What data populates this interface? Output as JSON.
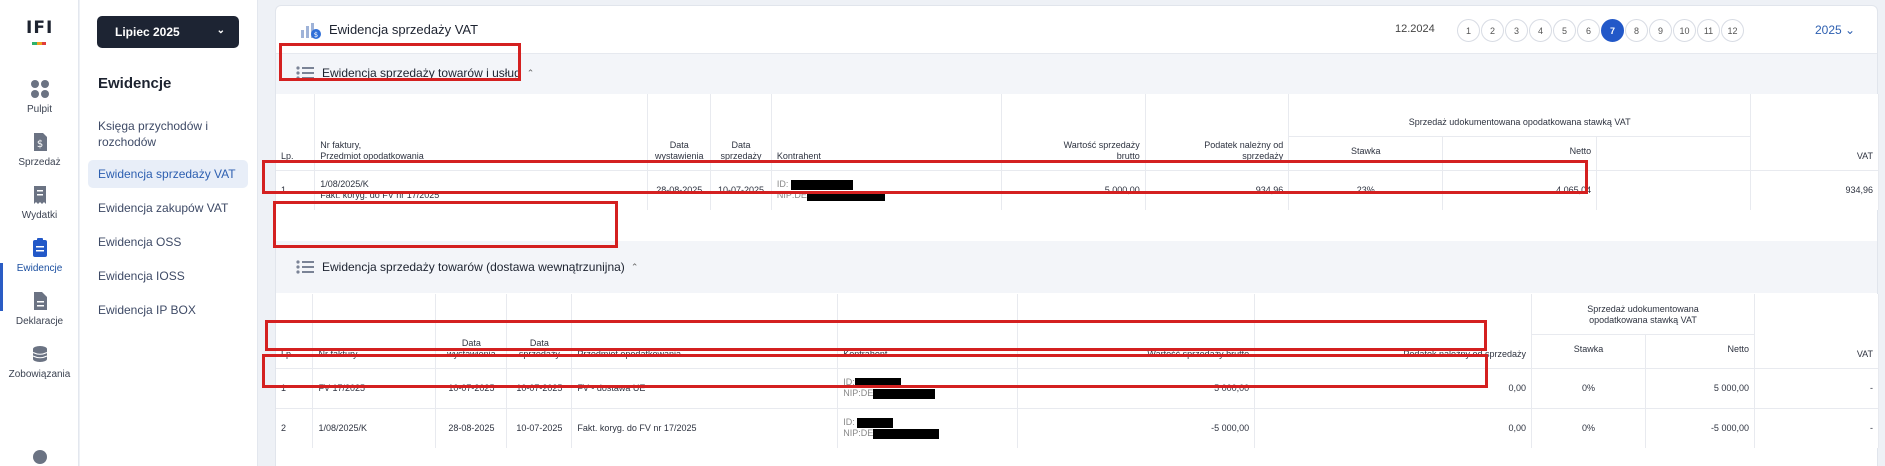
{
  "app": {
    "logo_text": "IFI",
    "month_selector": "Lipiec 2025"
  },
  "rail": [
    {
      "label": "Pulpit",
      "icon": "dashboard-icon"
    },
    {
      "label": "Sprzedaż",
      "icon": "invoice-dollar-icon"
    },
    {
      "label": "Wydatki",
      "icon": "receipt-icon"
    },
    {
      "label": "Ewidencje",
      "icon": "clipboard-icon",
      "active": true
    },
    {
      "label": "Deklaracje",
      "icon": "document-icon"
    },
    {
      "label": "Zobowiązania",
      "icon": "coins-icon"
    }
  ],
  "sidebar": {
    "title": "Ewidencje",
    "items": [
      {
        "label": "Księga przychodów i rozchodów"
      },
      {
        "label": "Ewidencja sprzedaży VAT",
        "active": true
      },
      {
        "label": "Ewidencja zakupów VAT"
      },
      {
        "label": "Ewidencja OSS"
      },
      {
        "label": "Ewidencja IOSS"
      },
      {
        "label": "Ewidencja IP BOX"
      }
    ]
  },
  "header": {
    "title": "Ewidencja sprzedaży VAT",
    "prev_period": "12.2024",
    "months": [
      "1",
      "2",
      "3",
      "4",
      "5",
      "6",
      "7",
      "8",
      "9",
      "10",
      "11",
      "12"
    ],
    "active_month": "7",
    "year": "2025",
    "year_chevron": "⌄"
  },
  "section1": {
    "title": "Ewidencja sprzedaży towarów i usług",
    "headers": {
      "lp": "Lp.",
      "nr": "Nr faktury,",
      "nr2": "Przedmiot opodatkowania",
      "data_wyst": "Data wystawienia",
      "data_sprz": "Data sprzedaży",
      "kontrahent": "Kontrahent",
      "wartosc": "Wartość sprzedaży brutto",
      "podatek": "Podatek należny od sprzedaży",
      "group": "Sprzedaż udokumentowana opodatkowana stawką VAT",
      "stawka": "Stawka",
      "netto": "Netto",
      "vat": "VAT"
    },
    "rows": [
      {
        "lp": "1",
        "nr": "1/08/2025/K",
        "przedmiot": "Fakt. koryg. do FV nr 17/2025",
        "data_wyst": "28-08-2025",
        "data_sprz": "10-07-2025",
        "id_label": "ID:",
        "nip_label": "NIP:DE",
        "wartosc": "5 000,00",
        "podatek": "934,96",
        "stawka": "23%",
        "netto": "4 065,04",
        "vat": "934,96"
      }
    ]
  },
  "section2": {
    "title": "Ewidencja sprzedaży towarów (dostawa wewnątrzunijna)",
    "headers": {
      "lp": "Lp.",
      "nr": "Nr faktury",
      "data_wyst": "Data wystawienia",
      "data_sprz": "Data sprzedaży",
      "przedmiot": "Przedmiot opodatkowania",
      "kontrahent": "Kontrahent",
      "wartosc": "Wartość sprzedaży brutto",
      "podatek": "Podatek należny od sprzedaży",
      "group": "Sprzedaż udokumentowana opodatkowana stawką VAT",
      "stawka": "Stawka",
      "netto": "Netto",
      "vat": "VAT"
    },
    "rows": [
      {
        "lp": "1",
        "nr": "FV 17/2025",
        "data_wyst": "10-07-2025",
        "data_sprz": "10-07-2025",
        "przedmiot": "FV - dostawa UE",
        "id_label": "ID:",
        "nip_label": "NIP:DE",
        "wartosc": "5 000,00",
        "podatek": "0,00",
        "stawka": "0%",
        "netto": "5 000,00",
        "vat": "-"
      },
      {
        "lp": "2",
        "nr": "1/08/2025/K",
        "data_wyst": "28-08-2025",
        "data_sprz": "10-07-2025",
        "przedmiot": "Fakt. koryg. do FV nr 17/2025",
        "id_label": "ID:",
        "nip_label": "NIP:DE",
        "wartosc": "-5 000,00",
        "podatek": "0,00",
        "stawka": "0%",
        "netto": "-5 000,00",
        "vat": "-"
      }
    ]
  },
  "colors": {
    "accent": "#2258c8",
    "dark_button": "#1d2433",
    "highlight_red": "#d42020"
  }
}
